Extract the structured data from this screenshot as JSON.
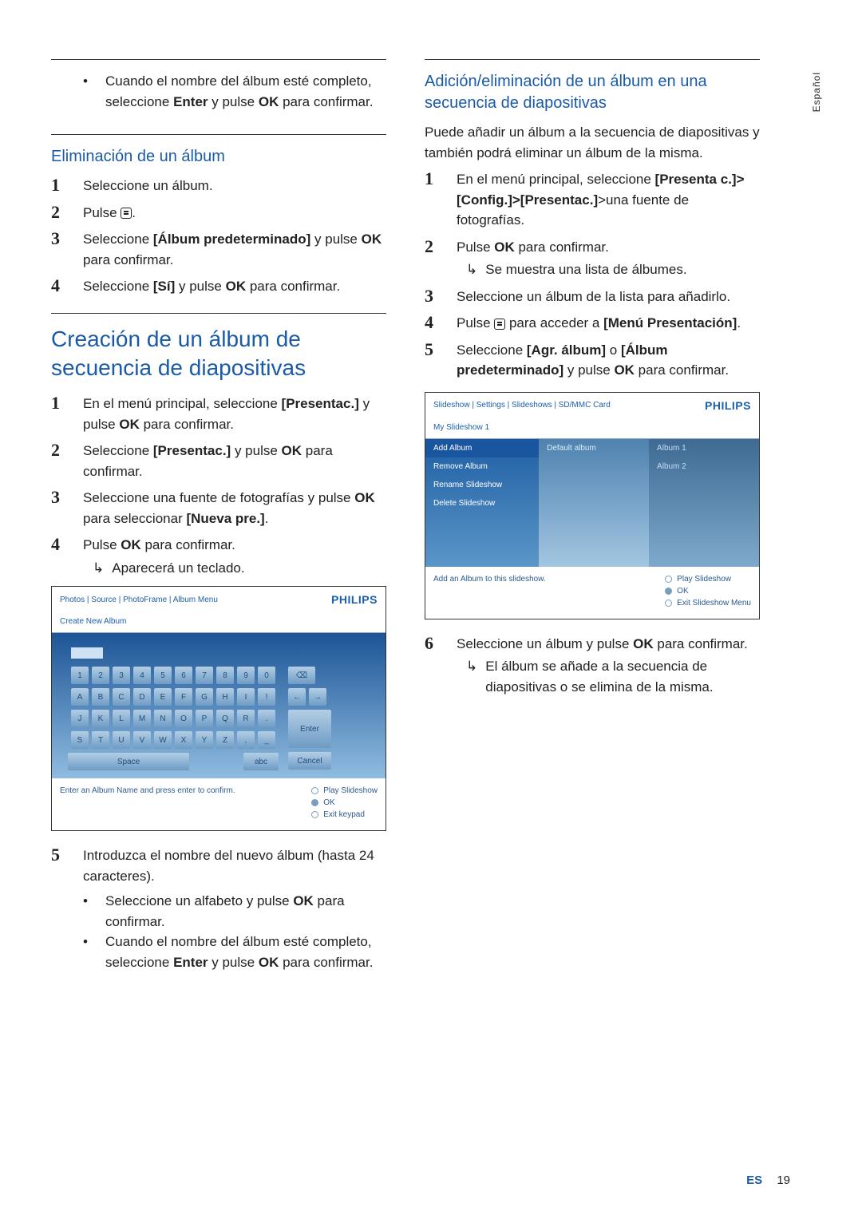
{
  "side_tab": "Español",
  "left": {
    "top_bullet": {
      "prefix": "Cuando el nombre del álbum esté completo, seleccione ",
      "bold1": "Enter",
      "mid": " y pulse ",
      "bold2": "OK",
      "suffix": " para confirmar."
    },
    "h3_delete": "Eliminación de un álbum",
    "delete_steps": {
      "s1": "Seleccione un álbum.",
      "s2": "Pulse ",
      "s3a": "Seleccione ",
      "s3b": "[Álbum predeterminado]",
      "s3c": " y pulse ",
      "s3d": "OK",
      "s3e": " para confirmar.",
      "s4a": "Seleccione ",
      "s4b": "[Sí]",
      "s4c": " y pulse ",
      "s4d": "OK",
      "s4e": " para confirmar."
    },
    "h2_create": "Creación de un álbum de secuencia de diapositivas",
    "create_steps": {
      "s1a": "En el menú principal, seleccione ",
      "s1b": "[Presentac.]",
      "s1c": " y pulse ",
      "s1d": "OK",
      "s1e": " para confirmar.",
      "s2a": "Seleccione ",
      "s2b": "[Presentac.]",
      "s2c": " y pulse ",
      "s2d": "OK",
      "s2e": " para confirmar.",
      "s3a": "Seleccione una fuente de fotografías y pulse ",
      "s3b": "OK",
      "s3c": " para seleccionar ",
      "s3d": "[Nueva pre.]",
      "s3e": ".",
      "s4a": "Pulse ",
      "s4b": "OK",
      "s4c": " para confirmar.",
      "s4_sub": "Aparecerá un teclado."
    },
    "kbd_shot": {
      "breadcrumb": "Photos | Source | PhotoFrame | Album Menu",
      "logo": "PHILIPS",
      "subtitle": "Create New Album",
      "rows": {
        "r1": [
          "1",
          "2",
          "3",
          "4",
          "5",
          "6",
          "7",
          "8",
          "9",
          "0"
        ],
        "r2": [
          "A",
          "B",
          "C",
          "D",
          "E",
          "F",
          "G",
          "H",
          "I",
          "!"
        ],
        "r3": [
          "J",
          "K",
          "L",
          "M",
          "N",
          "O",
          "P",
          "Q",
          "R",
          "."
        ],
        "r4": [
          "S",
          "T",
          "U",
          "V",
          "W",
          "X",
          "Y",
          "Z",
          ",",
          "_"
        ]
      },
      "space": "Space",
      "abc": "abc",
      "enter": "Enter",
      "cancel": "Cancel",
      "footer_left": "Enter an Album Name and press enter to confirm.",
      "footer_right": [
        "Play Slideshow",
        "OK",
        "Exit keypad"
      ]
    },
    "step5": {
      "num": "5",
      "text": "Introduzca el nombre del nuevo álbum (hasta 24 caracteres).",
      "b1a": "Seleccione un alfabeto y pulse ",
      "b1b": "OK",
      "b1c": " para confirmar.",
      "b2a": "Cuando el nombre del álbum esté completo, seleccione ",
      "b2b": "Enter",
      "b2c": " y pulse ",
      "b2d": "OK",
      "b2e": " para confirmar."
    }
  },
  "right": {
    "h3_addremove": "Adición/eliminación de un álbum en una secuencia de diapositivas",
    "intro": "Puede añadir un álbum a la secuencia de diapositivas y también podrá eliminar un álbum de la misma.",
    "steps": {
      "s1a": "En el menú principal, seleccione ",
      "s1b": "[Presenta c.]>[Config.]>[Presentac.]",
      "s1c": ">una fuente de fotografías.",
      "s2a": "Pulse ",
      "s2b": "OK",
      "s2c": " para confirmar.",
      "s2_sub": "Se muestra una lista de álbumes.",
      "s3": "Seleccione un álbum de la lista para añadirlo.",
      "s4a": "Pulse ",
      "s4b": " para acceder a ",
      "s4c": "[Menú Presentación]",
      "s4d": ".",
      "s5a": "Seleccione ",
      "s5b": "[Agr. álbum]",
      "s5c": " o ",
      "s5d": "[Álbum predeterminado]",
      "s5e": " y pulse ",
      "s5f": "OK",
      "s5g": " para confirmar."
    },
    "shot": {
      "breadcrumb": "Slideshow | Settings | Slideshows | SD/MMC Card",
      "logo": "PHILIPS",
      "subtitle": "My Slideshow 1",
      "col1": [
        "Add Album",
        "Remove Album",
        "Rename Slideshow",
        "Delete Slideshow"
      ],
      "col2": [
        "Default album"
      ],
      "col3": [
        "Album 1",
        "Album 2"
      ],
      "footer_left": "Add an Album to this slideshow.",
      "footer_right": [
        "Play Slideshow",
        "OK",
        "Exit Slideshow Menu"
      ]
    },
    "step6": {
      "num": "6",
      "a": "Seleccione un álbum y pulse ",
      "b": "OK",
      "c": " para confirmar.",
      "sub": "El álbum se añade a la secuencia de diapositivas o se elimina de la misma."
    }
  },
  "footer": {
    "lang": "ES",
    "page": "19"
  }
}
